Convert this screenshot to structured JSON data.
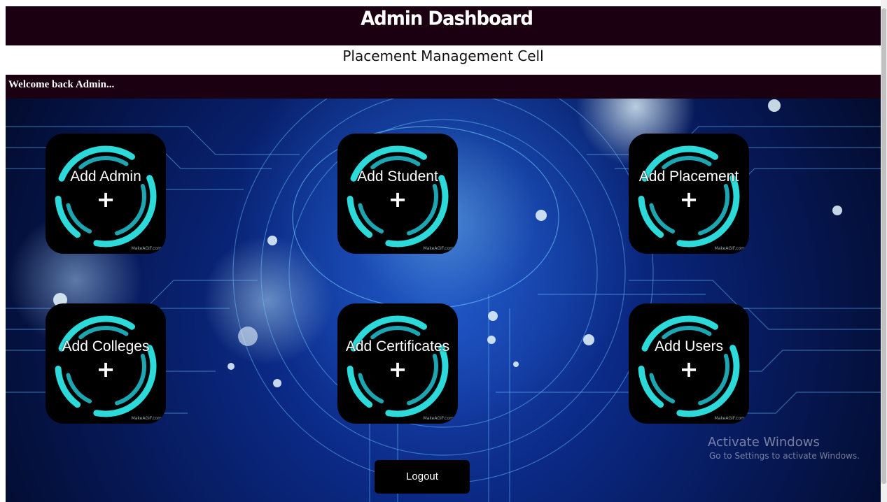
{
  "header": {
    "title": "Admin Dashboard"
  },
  "subheader": {
    "title": "Placement Management Cell"
  },
  "welcome": {
    "text": "Welcome back Admin..."
  },
  "tiles": [
    {
      "label": "Add Admin",
      "plus": "+",
      "watermark": "MakeAGIF.com"
    },
    {
      "label": "Add Student",
      "plus": "+",
      "watermark": "MakeAGIF.com"
    },
    {
      "label": "Add Placement",
      "plus": "+",
      "watermark": "MakeAGIF.com"
    },
    {
      "label": "Add Colleges",
      "plus": "+",
      "watermark": "MakeAGIF.com"
    },
    {
      "label": "Add Certificates",
      "plus": "+",
      "watermark": "MakeAGIF.com"
    },
    {
      "label": "Add Users",
      "plus": "+",
      "watermark": "MakeAGIF.com"
    }
  ],
  "logout": {
    "label": "Logout"
  },
  "watermark_os": {
    "line1": "Activate Windows",
    "line2": "Go to Settings to activate Windows."
  },
  "colors": {
    "header_bg": "#1a0010",
    "ring_cyan": "#2ee6e6",
    "tile_bg": "#000000"
  }
}
